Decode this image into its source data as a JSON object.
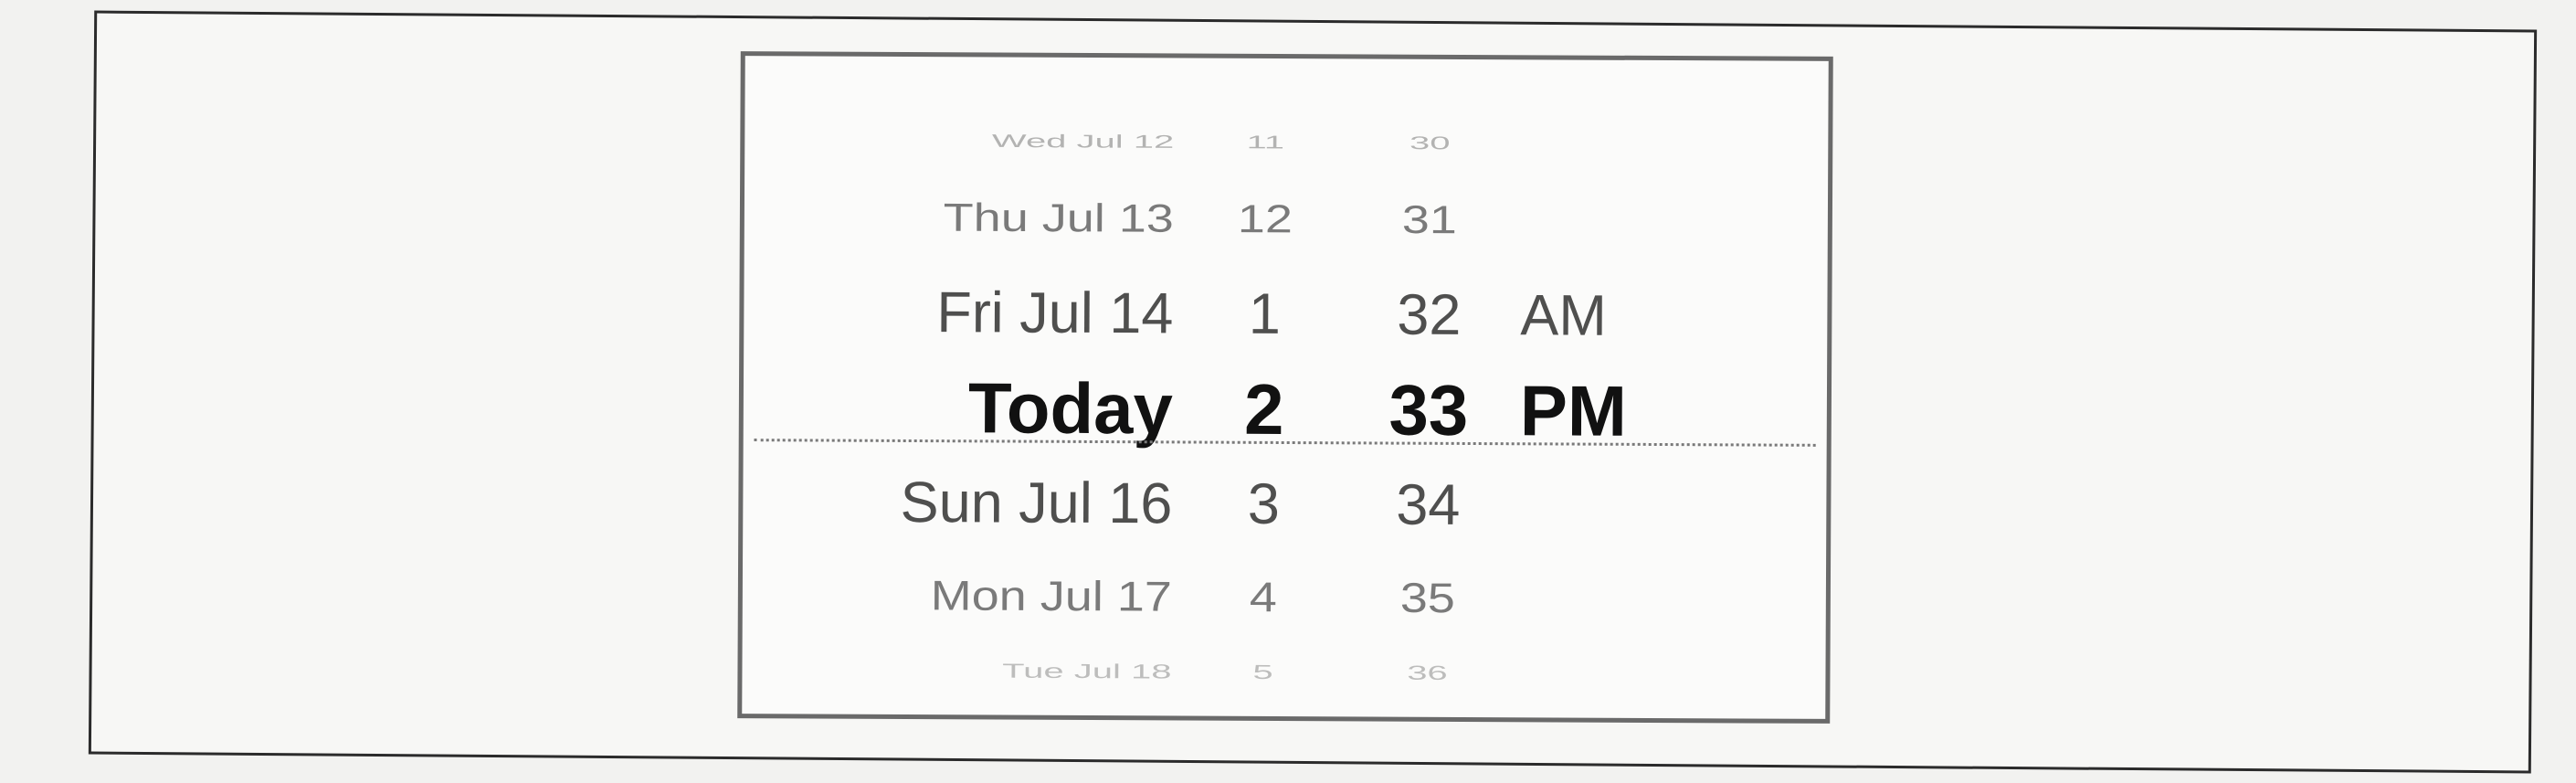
{
  "picker": {
    "rows": [
      {
        "date": "Wed Jul 12",
        "hour": "11",
        "minute": "30",
        "ampm": ""
      },
      {
        "date": "Thu Jul 13",
        "hour": "12",
        "minute": "31",
        "ampm": ""
      },
      {
        "date": "Fri Jul 14",
        "hour": "1",
        "minute": "32",
        "ampm": "AM"
      },
      {
        "date": "Today",
        "hour": "2",
        "minute": "33",
        "ampm": "PM"
      },
      {
        "date": "Sun Jul 16",
        "hour": "3",
        "minute": "34",
        "ampm": ""
      },
      {
        "date": "Mon Jul 17",
        "hour": "4",
        "minute": "35",
        "ampm": ""
      },
      {
        "date": "Tue Jul 18",
        "hour": "5",
        "minute": "36",
        "ampm": ""
      }
    ],
    "selected_index": 3
  }
}
